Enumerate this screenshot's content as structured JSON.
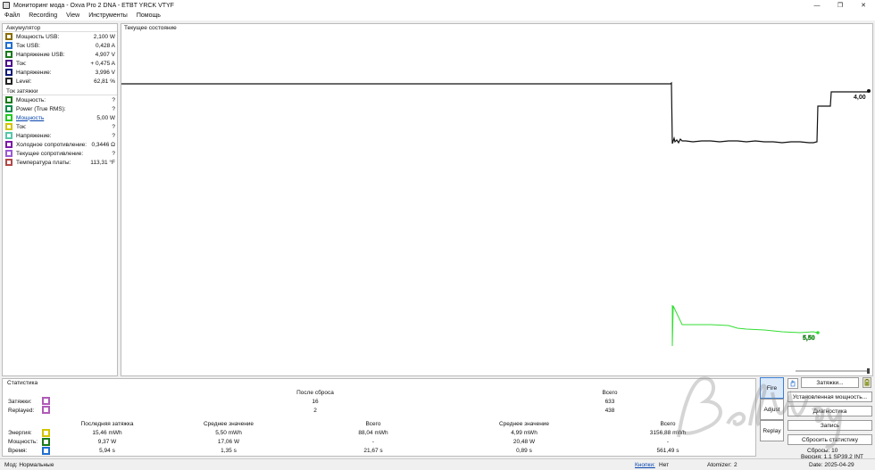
{
  "window": {
    "title": "Мониторинг мода - Oxva Pro 2 DNA - ETBT YRCK VTYF",
    "min_glyph": "—",
    "max_glyph": "❐",
    "close_glyph": "✕"
  },
  "menu": [
    "Файл",
    "Recording",
    "View",
    "Инструменты",
    "Помощь"
  ],
  "battery": {
    "title": "Аккумулятор",
    "rows": [
      {
        "label": "Мощность USB:",
        "value": "2,100 W",
        "color": "#8a6d00"
      },
      {
        "label": "Ток USB:",
        "value": "0,428 A",
        "color": "#1f6fd1"
      },
      {
        "label": "Напряжение USB:",
        "value": "4,907 V",
        "color": "#1a7a1a"
      },
      {
        "label": "Ток:",
        "value": "+ 0,475 A",
        "color": "#4b0c8c"
      },
      {
        "label": "Напряжение:",
        "value": "3,996 V",
        "color": "#0a1a7a"
      },
      {
        "label": "Level:",
        "value": "62,81 %",
        "color": "#222222"
      }
    ]
  },
  "puff": {
    "title": "Ток затяжки",
    "rows": [
      {
        "label": "Мощность:",
        "value": "?",
        "color": "#1a7a1a"
      },
      {
        "label": "Power (True RMS):",
        "value": "?",
        "color": "#0a8a4a"
      },
      {
        "label": "Мощность",
        "value": "5,00 W",
        "color": "#22cc22",
        "link": true
      },
      {
        "label": "Ток:",
        "value": "?",
        "color": "#d4c400"
      },
      {
        "label": "Напряжение:",
        "value": "?",
        "color": "#55c7a8"
      },
      {
        "label": "Холодное сопротивление:",
        "value": "0,3446 Ω",
        "color": "#7a1aa8"
      },
      {
        "label": "Текущее сопротивление:",
        "value": "?",
        "color": "#9a5ad4"
      },
      {
        "label": "Температура платы:",
        "value": "113,31 °F",
        "color": "#b04848"
      }
    ]
  },
  "chart": {
    "title": "Текущее состояние",
    "black_value": "4,00",
    "green_value": "5,50",
    "black_color": "#111111",
    "green_color": "#33dd33"
  },
  "stats": {
    "title": "Статистика",
    "after_reset": "После сброса",
    "total": "Всего",
    "puffs_label": "Затяжки:",
    "puffs_after": "16",
    "puffs_total": "633",
    "replayed_label": "Replayed:",
    "replayed_after": "2",
    "replayed_total": "438",
    "headers": [
      "Последняя затяжка",
      "Среднее значение",
      "Всего",
      "Среднее значение",
      "Всего"
    ],
    "rows": [
      {
        "label": "Энергия:",
        "color": "#d4c400",
        "values": [
          "15,46 mWh",
          "5,50 mWh",
          "88,04 mWh",
          "4,99 mWh",
          "3156,88 mWh"
        ]
      },
      {
        "label": "Мощность:",
        "color": "#1a7a1a",
        "values": [
          "9,37 W",
          "17,06 W",
          "-",
          "20,48 W",
          "-"
        ]
      },
      {
        "label": "Время:",
        "color": "#1f6fd1",
        "values": [
          "5,94 s",
          "1,35 s",
          "21,67 s",
          "0,89 s",
          "561,49 s"
        ]
      }
    ]
  },
  "controls": {
    "fire": "Fire",
    "adjust": "Adjust",
    "replay": "Replay",
    "puffs_btn": "Затяжки...",
    "set_power": "Установленная мощность...",
    "diagnostics": "Диагностика",
    "record": "Запись",
    "reset_stats": "Сбросить статистику",
    "resets": "Сбросы: 10",
    "version": "Версия: 1.1 SP39.2 INT",
    "date": "Date: 2025-04-29"
  },
  "status": {
    "mode": "Мод: Нормальные",
    "buttons_link": "Кнопки:",
    "buttons_value": "Нет",
    "atomizer_label": "Atomizer:",
    "atomizer_value": "2"
  }
}
